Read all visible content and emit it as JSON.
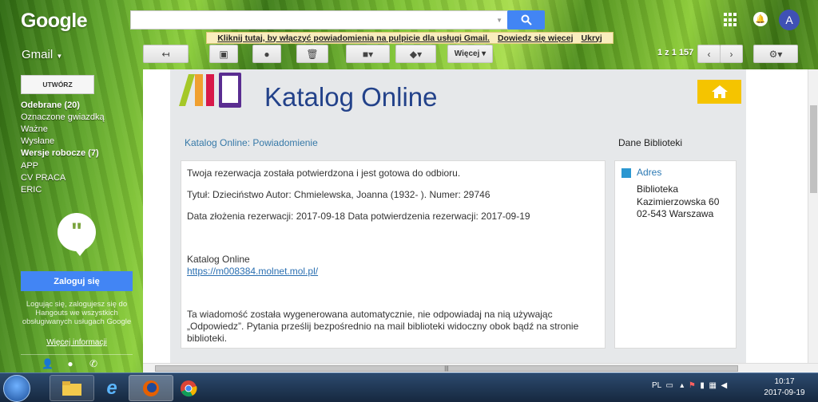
{
  "header": {
    "logo": "Google",
    "avatar_letter": "A",
    "notice_text": "Kliknij tutaj, by włączyć powiadomienia na pulpicie dla usługi Gmail.",
    "notice_more": "Dowiedz się więcej",
    "notice_hide": "Ukryj"
  },
  "toolbar": {
    "app_switch": "Gmail",
    "more_label": "Więcej",
    "pager": "1 z 1 157"
  },
  "sidebar": {
    "compose": "UTWÓRZ",
    "items": [
      {
        "label": "Odebrane (20)",
        "bold": true
      },
      {
        "label": "Oznaczone gwiazdką",
        "bold": false
      },
      {
        "label": "Ważne",
        "bold": false
      },
      {
        "label": "Wysłane",
        "bold": false
      },
      {
        "label": "Wersje robocze (7)",
        "bold": true
      },
      {
        "label": "APP",
        "bold": false
      },
      {
        "label": "CV PRACA",
        "bold": false
      },
      {
        "label": "ERIC",
        "bold": false
      }
    ],
    "hangouts_login": "Zaloguj się",
    "hangouts_hint": "Logując się, zalogujesz się do Hangouts we wszystkich obsługiwanych usługach Google",
    "hangouts_more": "Więcej informacji"
  },
  "email": {
    "brand_title": "Katalog Online",
    "notification_title": "Katalog Online: Powiadomienie",
    "library_header": "Dane Biblioteki",
    "line1": "Twoja rezerwacja została potwierdzona i jest gotowa do odbioru.",
    "line2": "Tytuł: Dzieciństwo Autor: Chmielewska, Joanna (1932- ). Numer: 29746",
    "line3": "Data złożenia rezerwacji: 2017-09-18 Data potwierdzenia rezerwacji: 2017-09-19",
    "signature": "Katalog Online",
    "link": "https://m008384.molnet.mol.pl/",
    "footer": "Ta wiadomość została wygenerowana automatycznie, nie odpowiadaj na nią używając „Odpowiedz”. Pytania prześlij bezpośrednio na mail biblioteki widoczny obok bądź na stronie biblioteki.",
    "address_label": "Adres",
    "address_line1": "Biblioteka",
    "address_line2": "Kazimierzowska 60",
    "address_line3": "02-543 Warszawa"
  },
  "taskbar": {
    "lang": "PL",
    "time": "10:17",
    "date": "2017-09-19"
  },
  "colors": {
    "accent_blue": "#4285f4",
    "brand_navy": "#23428a",
    "home_yellow": "#f5c400",
    "link_blue": "#2a6fb1"
  }
}
